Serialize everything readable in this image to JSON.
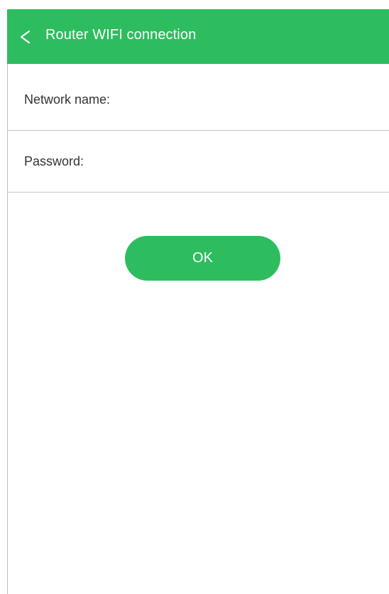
{
  "header": {
    "title": "Router WIFI connection",
    "back_icon": "chevron-left-icon",
    "background_color": "#2dbd5f"
  },
  "form": {
    "network_name": {
      "label": "Network name:",
      "value": "",
      "placeholder": ""
    },
    "password": {
      "label": "Password:",
      "value": "",
      "placeholder": ""
    }
  },
  "actions": {
    "ok_label": "OK",
    "ok_color": "#2dbd5f"
  }
}
